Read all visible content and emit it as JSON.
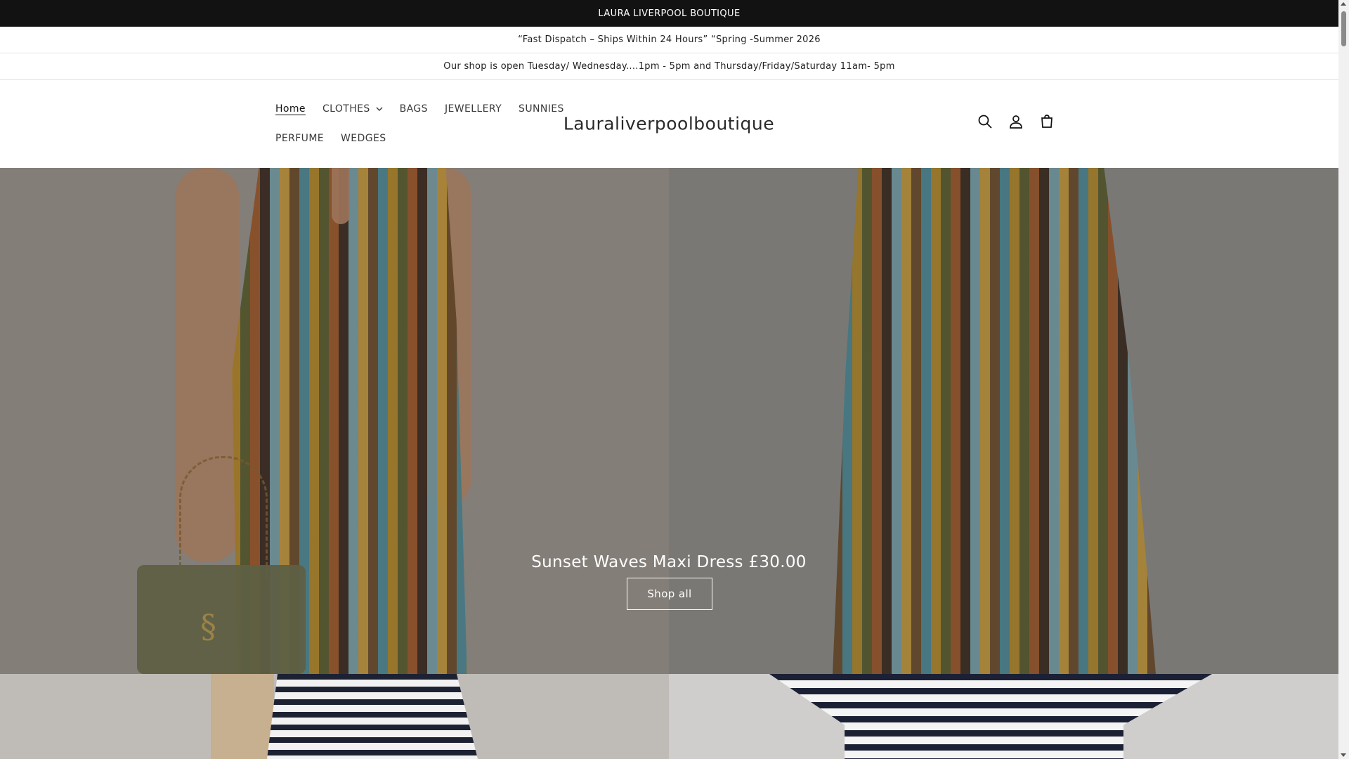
{
  "announcements": {
    "top": "LAURA LIVERPOOL BOUTIQUE",
    "line1": "“Fast Dispatch – Ships Within 24 Hours” “Spring -Summer 2026",
    "line2": "Our shop is open Tuesday/ Wednesday....1pm - 5pm and Thursday/Friday/Saturday 11am- 5pm"
  },
  "header": {
    "logo": "Lauraliverpoolboutique",
    "nav": {
      "home": "Home",
      "clothes": "CLOTHES",
      "bags": "BAGS",
      "jewellery": "JEWELLERY",
      "sunnies": "SUNNIES",
      "perfume": "PERFUME",
      "wedges": "WEDGES"
    },
    "icons": [
      "search-icon",
      "account-icon",
      "cart-icon"
    ]
  },
  "hero": {
    "heading": "Sunset Waves Maxi Dress £30.00",
    "button": "Shop all"
  },
  "colors": {
    "announcement_bg": "#121212",
    "text": "#121212",
    "background": "#ffffff"
  }
}
